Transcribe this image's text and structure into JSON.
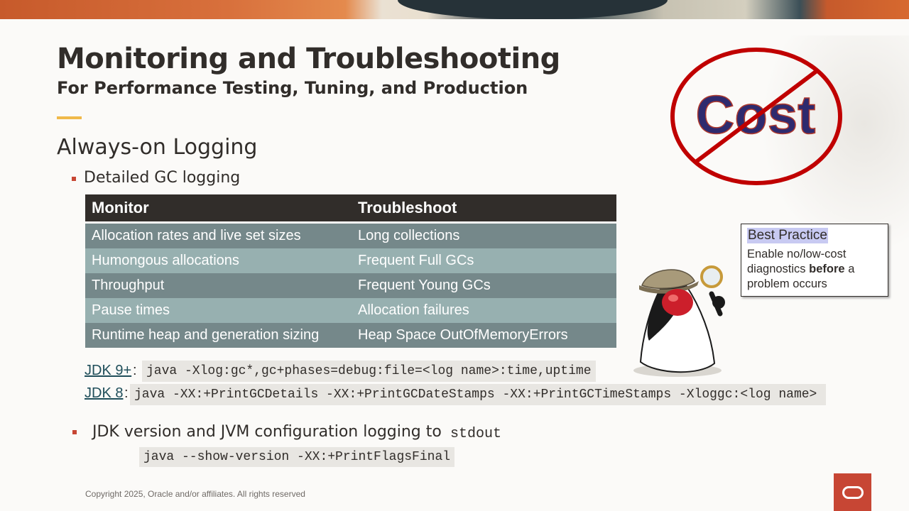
{
  "slide": {
    "title": "Monitoring and Troubleshooting",
    "subtitle": "For Performance Testing, Tuning, and Production",
    "section_heading": "Always-on Logging",
    "bullet1": "Detailed GC logging",
    "bullet2_prefix": "JDK version and JVM configuration logging to",
    "bullet2_code": "stdout"
  },
  "table": {
    "headers": [
      "Monitor",
      "Troubleshoot"
    ],
    "rows": [
      [
        "Allocation rates and live set sizes",
        "Long collections"
      ],
      [
        "Humongous allocations",
        "Frequent Full GCs"
      ],
      [
        "Throughput",
        "Frequent Young GCs"
      ],
      [
        "Pause times",
        "Allocation failures"
      ],
      [
        "Runtime heap and generation sizing",
        "Heap Space OutOfMemoryErrors"
      ]
    ]
  },
  "commands": {
    "jdk9_label": "JDK 9+",
    "jdk9_cmd": "java -Xlog:gc*,gc+phases=debug:file=<log name>:time,uptime",
    "jdk8_label": "JDK 8",
    "jdk8_cmd": "java -XX:+PrintGCDetails -XX:+PrintGCDateStamps -XX:+PrintGCTimeStamps -Xloggc:<log name>",
    "version_cmd": "java --show-version -XX:+PrintFlagsFinal",
    "colon": ":"
  },
  "callout": {
    "title": "Best Practice",
    "line_prefix": "Enable no/low-cost diagnostics",
    "emphasis": "before",
    "line_suffix": "a problem occurs"
  },
  "graphic": {
    "cost_word": "Cost"
  },
  "footer": {
    "copyright": "Copyright 2025, Oracle and/or affiliates. All rights reserved"
  },
  "colors": {
    "accent_bar": "#f0b94a",
    "bullet": "#c74634",
    "table_header": "#312d2a",
    "row_dark": "#75888a",
    "row_light": "#97b0b0",
    "no_sign": "#c00000",
    "cost_text": "#2e2a6e",
    "oracle_red": "#c74634"
  }
}
